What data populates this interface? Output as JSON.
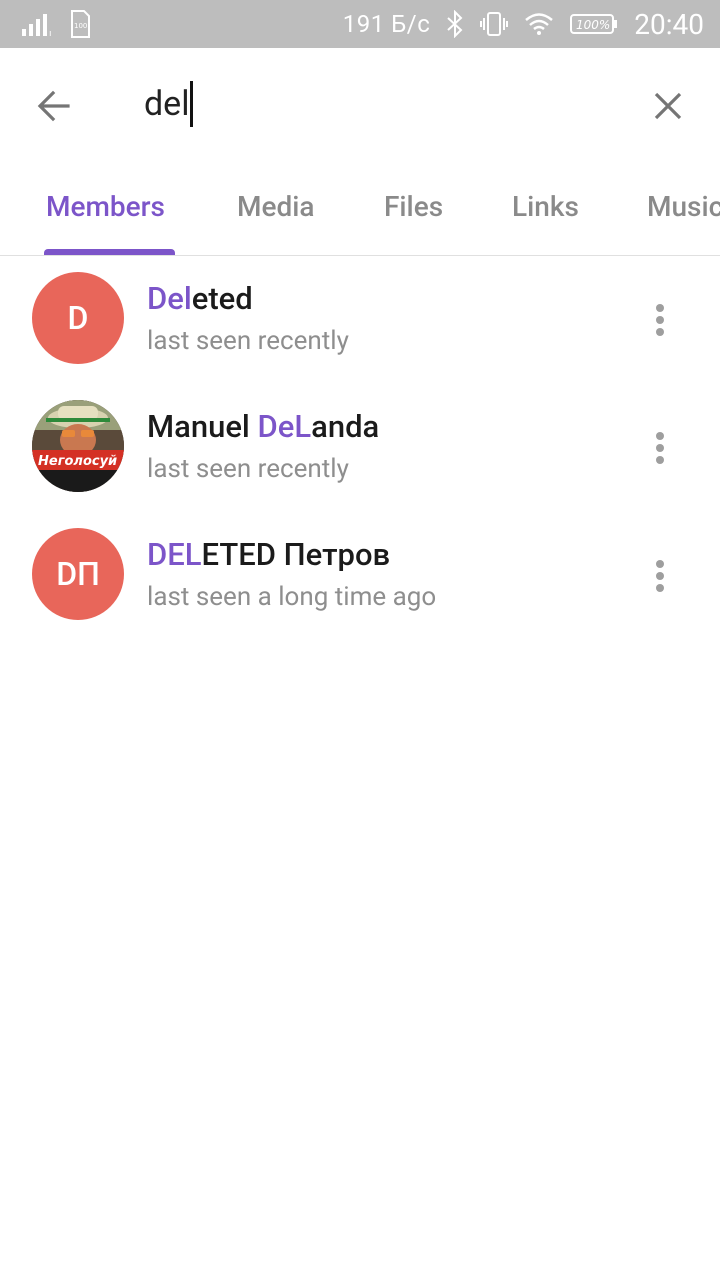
{
  "status_bar": {
    "speed": "191 Б/с",
    "battery_text": "100%",
    "time": "20:40",
    "sim_label": "100"
  },
  "search": {
    "query": "del"
  },
  "tabs": [
    {
      "label": "Members",
      "active": true
    },
    {
      "label": "Media",
      "active": false
    },
    {
      "label": "Files",
      "active": false
    },
    {
      "label": "Links",
      "active": false
    },
    {
      "label": "Music",
      "active": false
    }
  ],
  "members": [
    {
      "initials": "D",
      "name_highlight": "Del",
      "name_rest": "eted",
      "name_prefix": "",
      "status": "last seen recently",
      "avatar_color": "#e8665a"
    },
    {
      "initials": "",
      "name_prefix": "Manuel ",
      "name_highlight": "DeL",
      "name_rest": "anda",
      "status": "last seen recently",
      "avatar_caption": "Неголосуй"
    },
    {
      "initials": "DП",
      "name_prefix": "",
      "name_highlight": "DEL",
      "name_rest": "ETED Петров",
      "status": "last seen a long time ago",
      "avatar_color": "#e8665a"
    }
  ],
  "colors": {
    "accent": "#7c55c9",
    "avatar_red": "#e8665a",
    "status_bar": "#bdbdbd"
  }
}
